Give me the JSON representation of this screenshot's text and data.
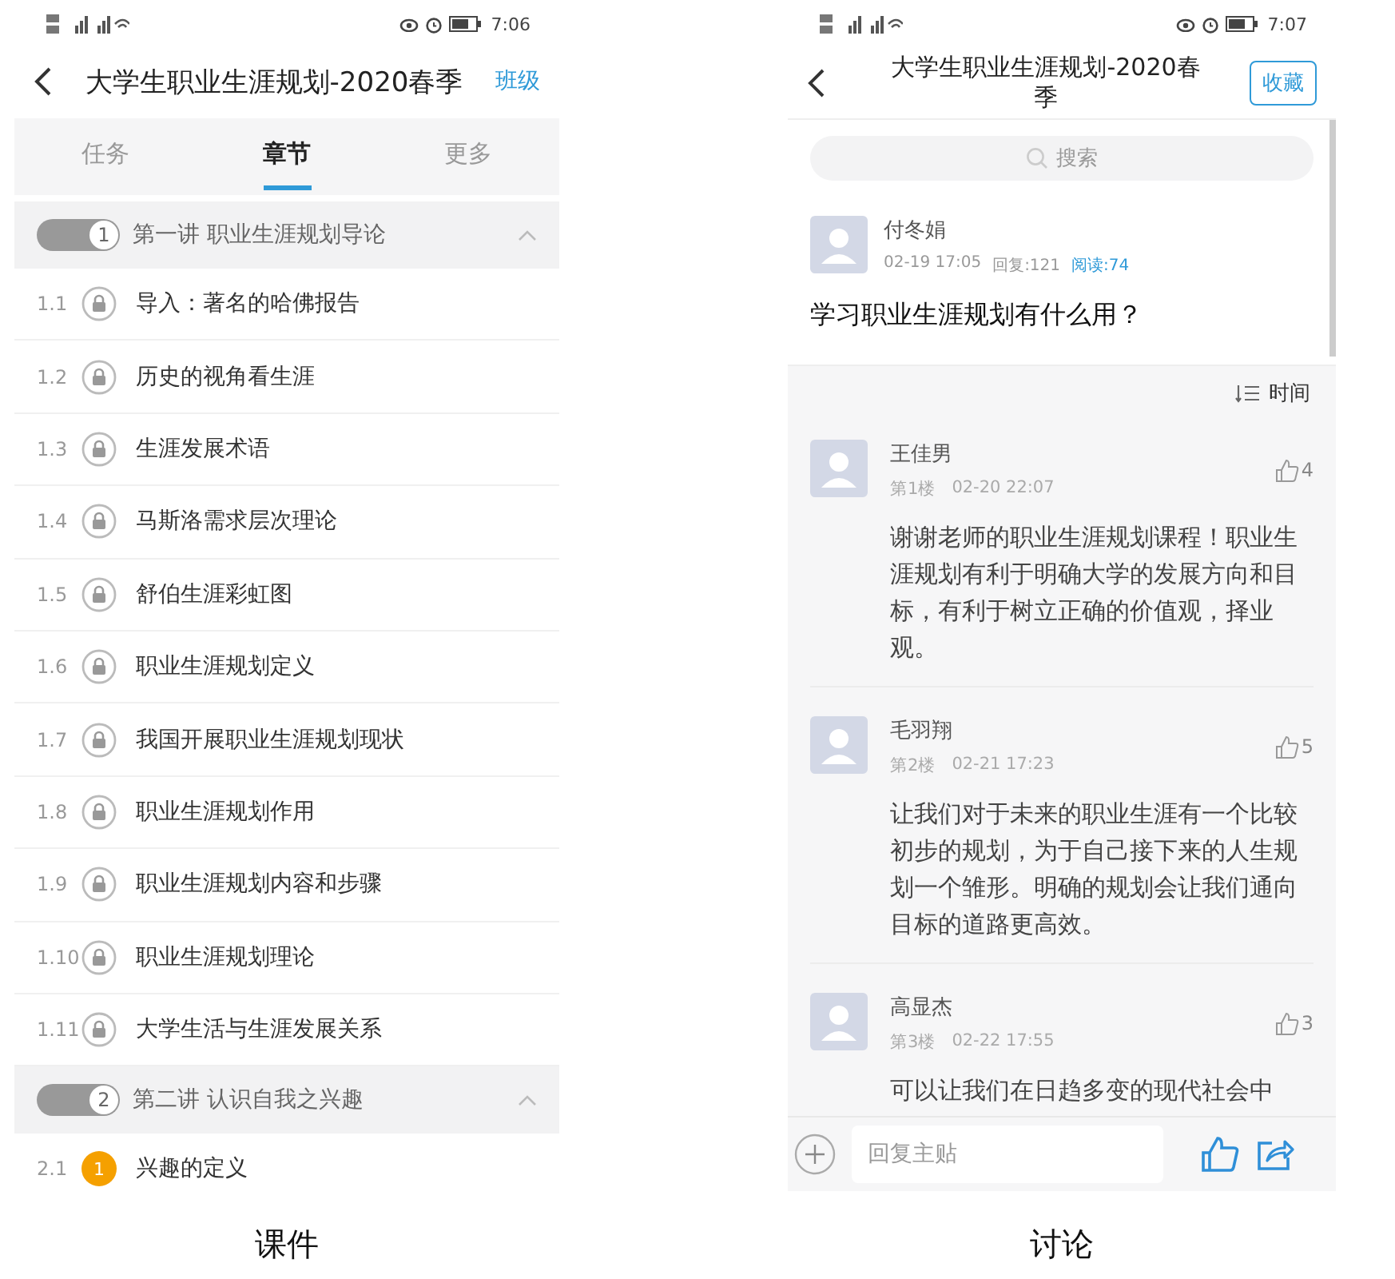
{
  "left_screen": {
    "caption": "课件",
    "status_bar": {
      "time": "7:06"
    },
    "header": {
      "title": "大学生职业生涯规划-2020春季",
      "action": "班级"
    },
    "tabs": [
      {
        "label": "任务",
        "selected": false
      },
      {
        "label": "章节",
        "selected": true
      },
      {
        "label": "更多",
        "selected": false
      }
    ],
    "sections": [
      {
        "number": "1",
        "title": "第一讲  职业生涯规划导论",
        "expanded": true,
        "items": [
          {
            "index": "1.1",
            "title": "导入：著名的哈佛报告",
            "kind": "locked"
          },
          {
            "index": "1.2",
            "title": "历史的视角看生涯",
            "kind": "locked"
          },
          {
            "index": "1.3",
            "title": "生涯发展术语",
            "kind": "locked"
          },
          {
            "index": "1.4",
            "title": "马斯洛需求层次理论",
            "kind": "locked"
          },
          {
            "index": "1.5",
            "title": "舒伯生涯彩虹图",
            "kind": "locked"
          },
          {
            "index": "1.6",
            "title": "职业生涯规划定义",
            "kind": "locked"
          },
          {
            "index": "1.7",
            "title": "我国开展职业生涯规划现状",
            "kind": "locked"
          },
          {
            "index": "1.8",
            "title": "职业生涯规划作用",
            "kind": "locked"
          },
          {
            "index": "1.9",
            "title": "职业生涯规划内容和步骤",
            "kind": "locked"
          },
          {
            "index": "1.10",
            "title": "职业生涯规划理论",
            "kind": "locked"
          },
          {
            "index": "1.11",
            "title": "大学生活与生涯发展关系",
            "kind": "locked"
          }
        ]
      },
      {
        "number": "2",
        "title": "第二讲 认识自我之兴趣",
        "expanded": true,
        "items": [
          {
            "index": "2.1",
            "title": "兴趣的定义",
            "kind": "task",
            "badge": "1"
          }
        ]
      }
    ]
  },
  "right_screen": {
    "caption": "讨论",
    "status_bar": {
      "time": "7:07"
    },
    "header": {
      "title": "大学生职业生涯规划-2020春季",
      "action": "收藏"
    },
    "search": {
      "placeholder": "搜索"
    },
    "post": {
      "author": "付冬娟",
      "time": "02-19 17:05",
      "replies": "回复:121",
      "reads": "阅读:74",
      "question": "学习职业生涯规划有什么用？"
    },
    "sort": {
      "label": "时间"
    },
    "comments": [
      {
        "author": "王佳男",
        "floor": "第1楼",
        "time": "02-20 22:07",
        "likes": "4",
        "text": "谢谢老师的职业生涯规划课程！职业生涯规划有利于明确大学的发展方向和目标，有利于树立正确的价值观，择业观。"
      },
      {
        "author": "毛羽翔",
        "floor": "第2楼",
        "time": "02-21 17:23",
        "likes": "5",
        "text": "让我们对于未来的职业生涯有一个比较初步的规划，为于自己接下来的人生规划一个雏形。明确的规划会让我们通向目标的道路更高效。"
      },
      {
        "author": "高显杰",
        "floor": "第3楼",
        "time": "02-22 17:55",
        "likes": "3",
        "text": "可以让我们在日趋多变的现代社会中"
      }
    ],
    "reply": {
      "placeholder": "回复主贴"
    }
  }
}
